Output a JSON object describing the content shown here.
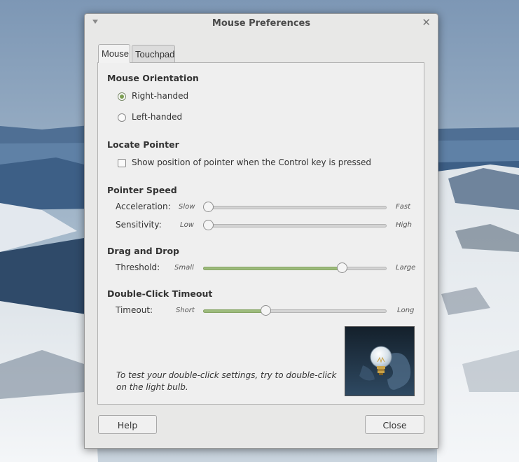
{
  "window": {
    "title": "Mouse Preferences"
  },
  "tabs": [
    {
      "label": "Mouse",
      "active": true
    },
    {
      "label": "Touchpad",
      "active": false
    }
  ],
  "orientation": {
    "heading": "Mouse Orientation",
    "options": [
      {
        "label": "Right-handed",
        "checked": true
      },
      {
        "label": "Left-handed",
        "checked": false
      }
    ]
  },
  "locate_pointer": {
    "heading": "Locate Pointer",
    "checkbox_label": "Show position of pointer when the Control key is pressed",
    "checked": false
  },
  "pointer_speed": {
    "heading": "Pointer Speed",
    "acceleration": {
      "label": "Acceleration:",
      "min_label": "Slow",
      "max_label": "Fast",
      "value": 0.0
    },
    "sensitivity": {
      "label": "Sensitivity:",
      "min_label": "Low",
      "max_label": "High",
      "value": 0.0
    }
  },
  "drag_and_drop": {
    "heading": "Drag and Drop",
    "threshold": {
      "label": "Threshold:",
      "min_label": "Small",
      "max_label": "Large",
      "value": 0.77
    }
  },
  "double_click": {
    "heading": "Double-Click Timeout",
    "timeout": {
      "label": "Timeout:",
      "min_label": "Short",
      "max_label": "Long",
      "value": 0.33
    },
    "test_text": "To test your double-click settings, try to double-click on the light bulb."
  },
  "buttons": {
    "help": "Help",
    "close": "Close"
  },
  "icons": {
    "window_menu": "chevron-down-icon",
    "window_close": "close-icon",
    "test_image": "light-bulb-icon"
  },
  "colors": {
    "accent": "#9dbb7c",
    "radio_dot": "#7b9d52"
  }
}
